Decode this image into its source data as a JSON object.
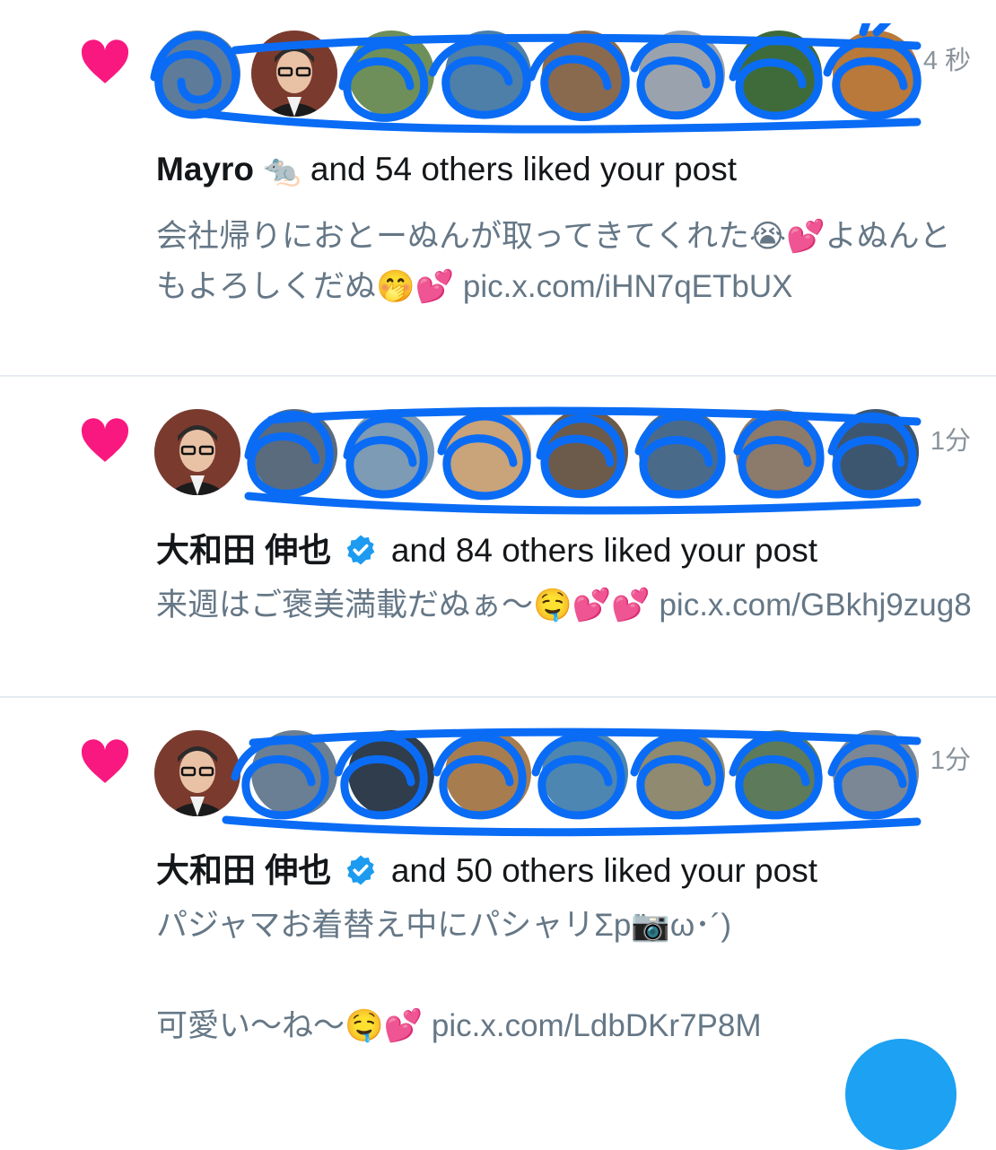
{
  "notifications": [
    {
      "time": "4 秒",
      "actor": "Mayro",
      "actor_emoji": "🐀",
      "action": "and 54 others liked your post",
      "verified": false,
      "text": "会社帰りにおとーぬんが取ってきてくれた😭💕よぬんともよろしくだぬ🤭💕 pic.x.com/iHN7qETbUX"
    },
    {
      "time": "1分",
      "actor": "大和田 伸也",
      "action": "and 84 others liked your post",
      "verified": true,
      "text": "来週はご褒美満載だぬぁ〜🤤💕💕 pic.x.com/GBkhj9zug8"
    },
    {
      "time": "1分",
      "actor": "大和田 伸也",
      "action": "and 50 others liked your post",
      "verified": true,
      "text": "パジャマお着替え中にパシャリΣp📷ω･´)\n\n可愛い〜ね〜🤤💕 pic.x.com/LdbDKr7P8M"
    }
  ],
  "colors": {
    "heart": "#f91880",
    "verified": "#1d9bf0",
    "scribble": "#0a6cf5",
    "fab": "#1da1f2"
  },
  "icons": {
    "like": "heart-icon",
    "verified": "verified-badge-icon",
    "compose": "compose-button"
  }
}
